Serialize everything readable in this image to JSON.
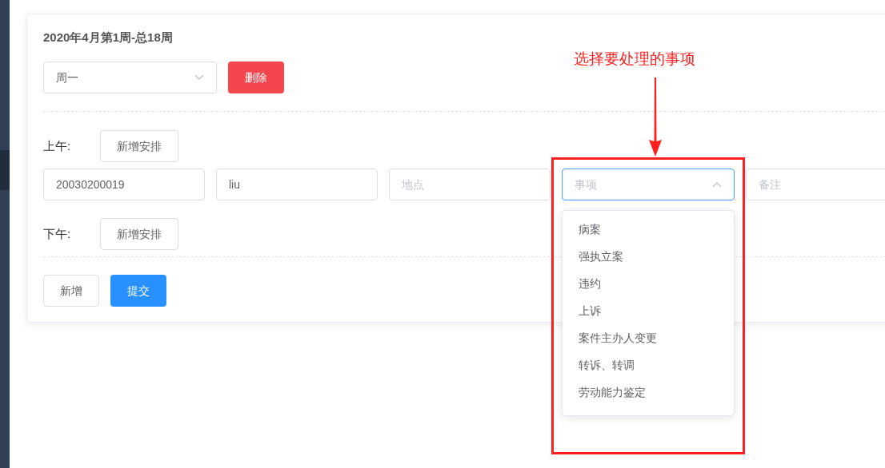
{
  "header": {
    "title": "2020年4月第1周-总18周"
  },
  "day_select": {
    "value": "周一",
    "expanded": false
  },
  "delete_button": "删除",
  "sections": [
    {
      "label": "上午:",
      "add_button": "新增安排",
      "fields": [
        {
          "kind": "input",
          "value": "20030200019"
        },
        {
          "kind": "input",
          "value": "liu"
        },
        {
          "kind": "input",
          "placeholder": "地点"
        },
        {
          "kind": "select",
          "placeholder": "事项",
          "expanded": true,
          "options": [
            "病案",
            "强执立案",
            "违约",
            "上诉",
            "案件主办人变更",
            "转诉、转调",
            "劳动能力鉴定"
          ]
        },
        {
          "kind": "input",
          "placeholder": "备注"
        }
      ]
    },
    {
      "label": "下午:",
      "add_button": "新增安排"
    }
  ],
  "footer_buttons": [
    {
      "label": "新增",
      "kind": "default"
    },
    {
      "label": "提交",
      "kind": "primary"
    }
  ],
  "annotation": {
    "text": "选择要处理的事项"
  }
}
